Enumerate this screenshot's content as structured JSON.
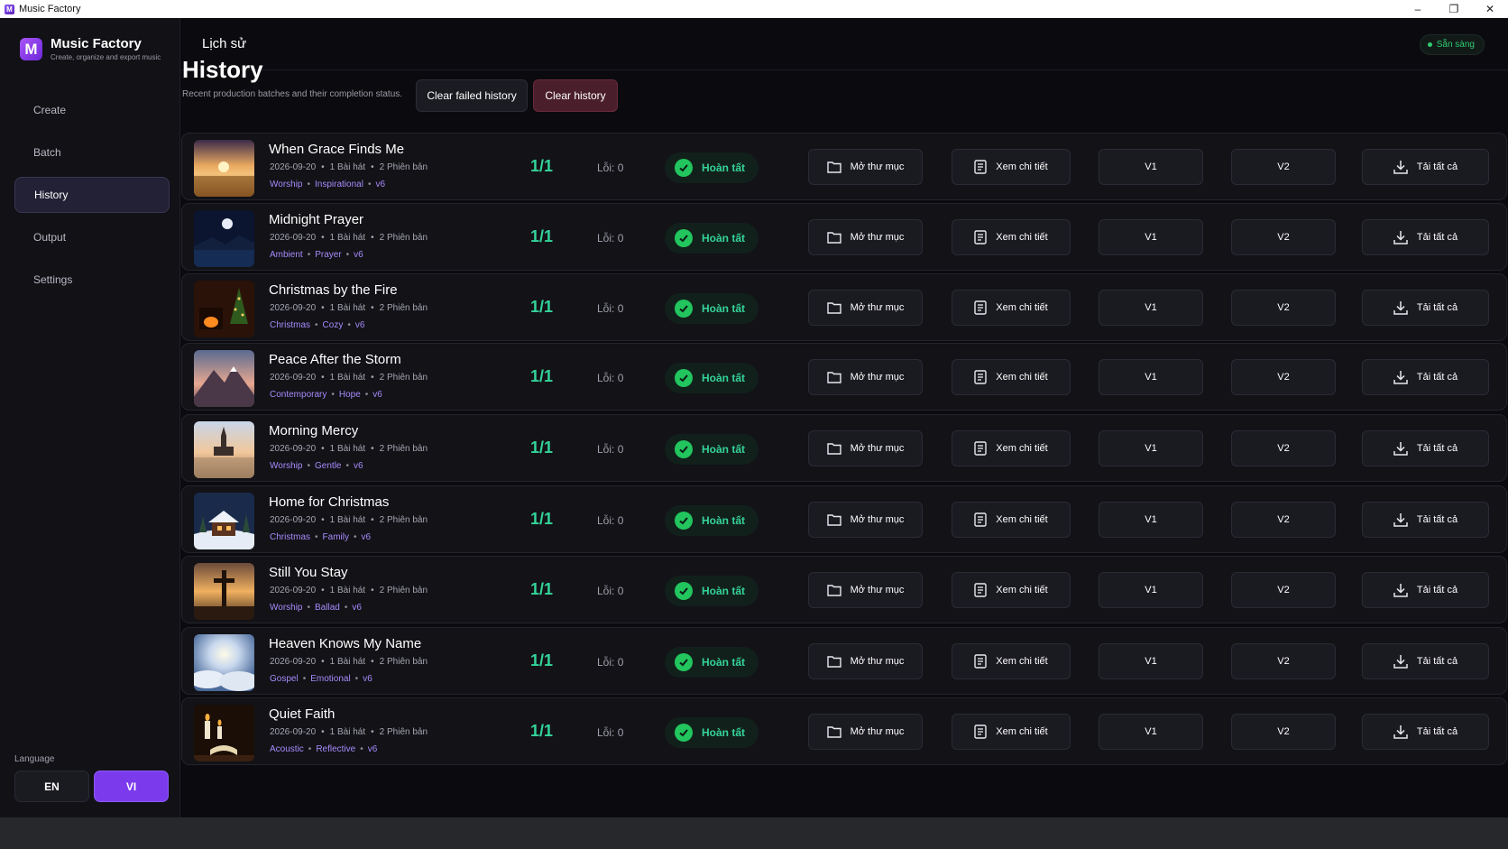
{
  "window": {
    "title": "Music Factory",
    "controls": [
      "minimize-icon",
      "restore-icon",
      "close-icon"
    ]
  },
  "brand": {
    "name": "Music Factory",
    "tagline": "Create, organize and export music",
    "logo_letter": "M"
  },
  "nav": [
    {
      "label": "Create",
      "active": false
    },
    {
      "label": "Batch",
      "active": false
    },
    {
      "label": "History",
      "active": true
    },
    {
      "label": "Output",
      "active": false
    },
    {
      "label": "Settings",
      "active": false
    }
  ],
  "language": {
    "label": "Language",
    "options": [
      "EN",
      "VI"
    ],
    "selected": "VI"
  },
  "topbar": {
    "title": "Lịch sử",
    "status": "Sẵn sàng"
  },
  "page": {
    "title": "History",
    "subtitle": "Recent production batches and their completion status.",
    "clear_failed_label": "Clear failed history",
    "clear_label": "Clear history"
  },
  "row_labels": {
    "error_prefix": "Lỗi: ",
    "status": "Hoàn tất",
    "open_folder": "Mở thư mục",
    "view_detail": "Xem chi tiết",
    "v1": "V1",
    "v2": "V2",
    "download_all": "Tải tất cả"
  },
  "rows": [
    {
      "title": "When Grace Finds Me",
      "date": "2026-09-20",
      "songs": "1 Bài hát",
      "versions": "2 Phiên bản",
      "tags": [
        "Worship",
        "Inspirational",
        "v6"
      ],
      "count": "1/1",
      "errors": "0",
      "thumb": "sunrise-field"
    },
    {
      "title": "Midnight Prayer",
      "date": "2026-09-20",
      "songs": "1 Bài hát",
      "versions": "2 Phiên bản",
      "tags": [
        "Ambient",
        "Prayer",
        "v6"
      ],
      "count": "1/1",
      "errors": "0",
      "thumb": "moon-lake"
    },
    {
      "title": "Christmas by the Fire",
      "date": "2026-09-20",
      "songs": "1 Bài hát",
      "versions": "2 Phiên bản",
      "tags": [
        "Christmas",
        "Cozy",
        "v6"
      ],
      "count": "1/1",
      "errors": "0",
      "thumb": "fireplace-tree"
    },
    {
      "title": "Peace After the Storm",
      "date": "2026-09-20",
      "songs": "1 Bài hát",
      "versions": "2 Phiên bản",
      "tags": [
        "Contemporary",
        "Hope",
        "v6"
      ],
      "count": "1/1",
      "errors": "0",
      "thumb": "mountain-sky"
    },
    {
      "title": "Morning Mercy",
      "date": "2026-09-20",
      "songs": "1 Bài hát",
      "versions": "2 Phiên bản",
      "tags": [
        "Worship",
        "Gentle",
        "v6"
      ],
      "count": "1/1",
      "errors": "0",
      "thumb": "church-lake"
    },
    {
      "title": "Home for Christmas",
      "date": "2026-09-20",
      "songs": "1 Bài hát",
      "versions": "2 Phiên bản",
      "tags": [
        "Christmas",
        "Family",
        "v6"
      ],
      "count": "1/1",
      "errors": "0",
      "thumb": "snow-cabin"
    },
    {
      "title": "Still You Stay",
      "date": "2026-09-20",
      "songs": "1 Bài hát",
      "versions": "2 Phiên bản",
      "tags": [
        "Worship",
        "Ballad",
        "v6"
      ],
      "count": "1/1",
      "errors": "0",
      "thumb": "cross-sunset"
    },
    {
      "title": "Heaven Knows My Name",
      "date": "2026-09-20",
      "songs": "1 Bài hát",
      "versions": "2 Phiên bản",
      "tags": [
        "Gospel",
        "Emotional",
        "v6"
      ],
      "count": "1/1",
      "errors": "0",
      "thumb": "sun-clouds"
    },
    {
      "title": "Quiet Faith",
      "date": "2026-09-20",
      "songs": "1 Bài hát",
      "versions": "2 Phiên bản",
      "tags": [
        "Acoustic",
        "Reflective",
        "v6"
      ],
      "count": "1/1",
      "errors": "0",
      "thumb": "candle-book"
    }
  ],
  "colors": {
    "accent": "#7c3aed",
    "success": "#34d399",
    "tag": "#a78bfa",
    "danger_bg": "#4a1f2b"
  }
}
